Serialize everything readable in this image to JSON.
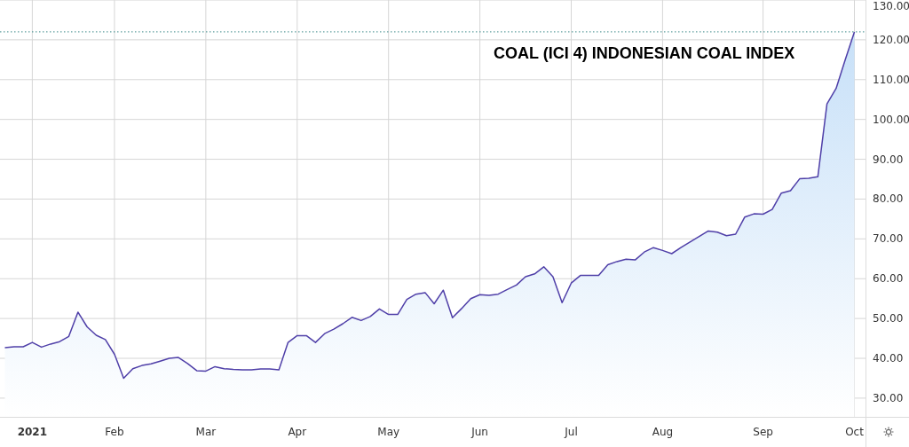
{
  "chart_data": {
    "type": "area",
    "title": "COAL (ICI 4) INDONESIAN COAL INDEX",
    "categories": [
      null,
      null,
      null,
      "2021",
      null,
      null,
      null,
      null,
      null,
      null,
      null,
      null,
      "Feb",
      null,
      null,
      null,
      null,
      null,
      null,
      null,
      null,
      null,
      "Mar",
      null,
      null,
      null,
      null,
      null,
      null,
      null,
      null,
      null,
      "Apr",
      null,
      null,
      null,
      null,
      null,
      null,
      null,
      null,
      null,
      "May",
      null,
      null,
      null,
      null,
      null,
      null,
      null,
      null,
      null,
      "Jun",
      null,
      null,
      null,
      null,
      null,
      null,
      null,
      null,
      null,
      "Jul",
      null,
      null,
      null,
      null,
      null,
      null,
      null,
      null,
      null,
      "Aug",
      null,
      null,
      null,
      null,
      null,
      null,
      null,
      null,
      null,
      null,
      "Sep",
      null,
      null,
      null,
      null,
      null,
      null,
      null,
      null,
      null,
      "Oct"
    ],
    "series": [
      {
        "color": "#4f3fa8",
        "values": [
          42.7,
          42.9,
          42.9,
          44.0,
          42.8,
          43.6,
          44.2,
          45.5,
          51.6,
          47.9,
          45.8,
          44.7,
          41.0,
          35.0,
          37.4,
          38.2,
          38.6,
          39.3,
          40.0,
          40.2,
          38.7,
          36.9,
          36.8,
          37.9,
          37.4,
          37.2,
          37.1,
          37.1,
          37.3,
          37.3,
          37.1,
          44.0,
          45.7,
          45.7,
          44.0,
          46.2,
          47.3,
          48.7,
          50.3,
          49.5,
          50.5,
          52.4,
          51.0,
          51.0,
          54.8,
          56.1,
          56.5,
          53.7,
          57.1,
          50.2,
          52.5,
          55.0,
          56.0,
          55.8,
          56.1,
          57.3,
          58.4,
          60.5,
          61.2,
          63.0,
          60.5,
          54.0,
          58.9,
          60.8,
          60.8,
          60.8,
          63.5,
          64.3,
          64.9,
          64.7,
          66.7,
          67.8,
          67.1,
          66.3,
          67.8,
          69.2,
          70.6,
          72.0,
          71.7,
          70.8,
          71.2,
          75.5,
          76.3,
          76.2,
          77.4,
          81.5,
          82.1,
          85.1,
          85.2,
          85.6,
          103.9,
          107.8,
          115.0,
          122.0
        ]
      }
    ],
    "ylim": [
      25.3,
      130
    ],
    "grid": true,
    "ref_lines": [
      {
        "axis": "y",
        "value": 122
      }
    ],
    "yticks": [
      {
        "value": 30,
        "label": "30.00"
      },
      {
        "value": 40,
        "label": "40.00"
      },
      {
        "value": 50,
        "label": "50.00"
      },
      {
        "value": 60,
        "label": "60.00"
      },
      {
        "value": 70,
        "label": "70.00"
      },
      {
        "value": 80,
        "label": "80.00"
      },
      {
        "value": 90,
        "label": "90.00"
      },
      {
        "value": 100,
        "label": "100.00"
      },
      {
        "value": 110,
        "label": "110.00"
      },
      {
        "value": 120,
        "label": "120.00"
      },
      {
        "value": 130,
        "label": "130.00"
      }
    ]
  }
}
